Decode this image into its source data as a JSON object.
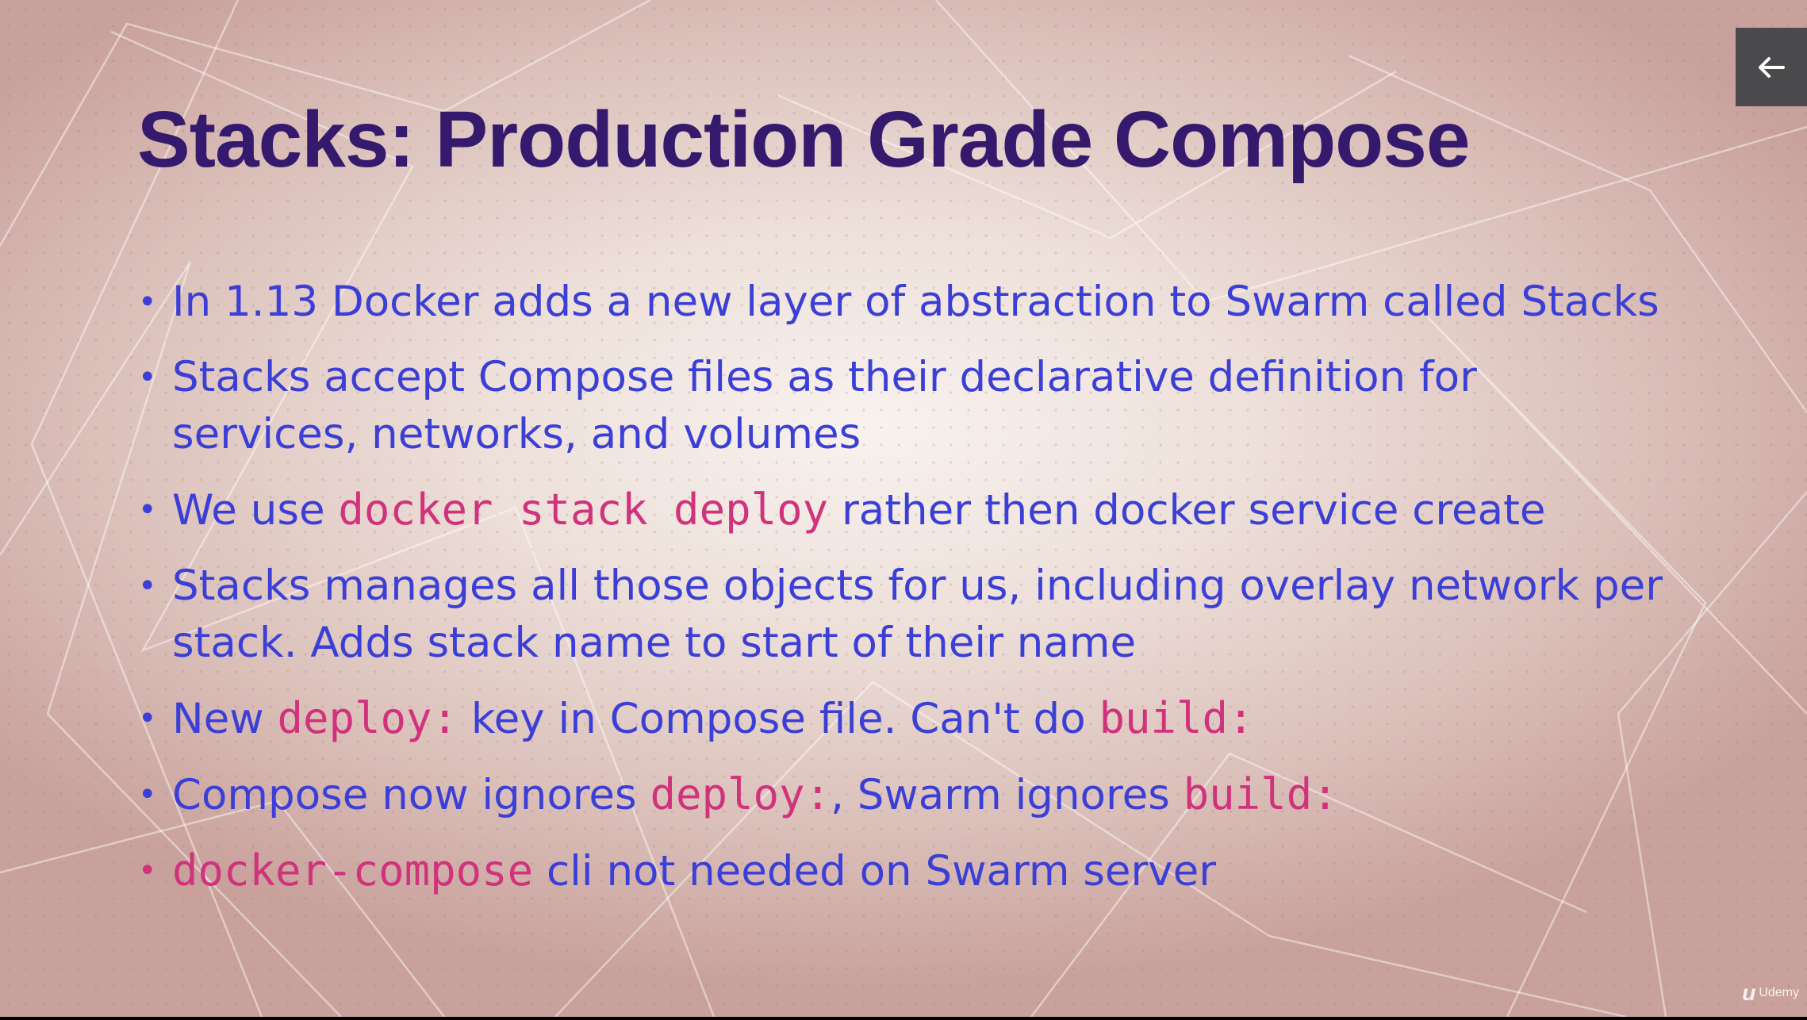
{
  "slide": {
    "title": "Stacks: Production Grade Compose",
    "bullets": [
      {
        "parts": [
          {
            "t": "In 1.13 Docker adds a new layer of abstraction to Swarm called Stacks"
          }
        ]
      },
      {
        "lines": [
          "Stacks accept Compose files as their declarative definition for",
          "services, networks, and volumes"
        ]
      },
      {
        "parts": [
          {
            "t": "We use "
          },
          {
            "code": "docker stack deploy"
          },
          {
            "t": " rather then docker service create"
          }
        ]
      },
      {
        "lines": [
          "Stacks manages all those objects for us, including overlay network per",
          "stack. Adds stack name to start of their name"
        ]
      },
      {
        "parts": [
          {
            "t": "New "
          },
          {
            "code": "deploy:"
          },
          {
            "t": " key in Compose file. Can't do "
          },
          {
            "code": "build:"
          }
        ]
      },
      {
        "parts": [
          {
            "t": "Compose now ignores "
          },
          {
            "code": "deploy:"
          },
          {
            "t": ", Swarm ignores "
          },
          {
            "code": "build:"
          }
        ]
      },
      {
        "parts": [
          {
            "code": "docker-compose"
          },
          {
            "t": " cli not needed on Swarm server"
          }
        ]
      }
    ]
  },
  "controls": {
    "back_icon": "arrow-left-icon"
  },
  "branding": {
    "logo_text": "Udemy",
    "logo_mark": "u"
  },
  "colors": {
    "title": "#35196d",
    "text": "#3b3fd6",
    "code": "#d0337c",
    "button_bg": "#4a4a4c"
  }
}
